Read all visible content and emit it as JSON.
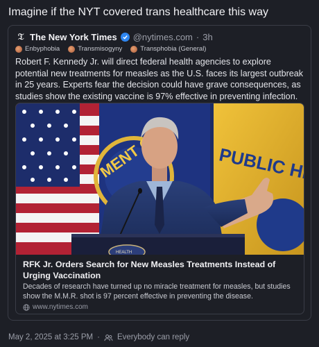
{
  "post": {
    "text": "Imagine if the NYT covered trans healthcare this way",
    "timestamp": "May 2, 2025 at 3:25 PM",
    "separator": "·",
    "reply_setting": "Everybody can reply"
  },
  "quote": {
    "author_name": "The New York Times",
    "handle": "@nytimes.com",
    "separator": "·",
    "age": "3h",
    "labels": [
      "Enbyphobia",
      "Transmisogyny",
      "Transphobia (General)"
    ],
    "text": "Robert F. Kennedy Jr. will direct federal health agencies to explore potential new treatments for measles as the U.S. faces its largest outbreak in 25 years. Experts fear the decision could have grave consequences, as studies show the existing vaccine is 97% effective in preventing infection."
  },
  "embed": {
    "title": "RFK Jr. Orders Search for New Measles Treatments Instead of Urging Vaccination",
    "description": "Decades of research have turned up no miracle treatment for measles, but studies show the M.M.R. shot is 97 percent effective in preventing the disease.",
    "domain": "www.nytimes.com",
    "podium_text": "HEALTH",
    "flag_text": "PUBLIC HE",
    "seal_text": "MENT OF"
  },
  "icons": {
    "logo": "nyt-logo-icon",
    "verified": "verified-badge-icon",
    "globe": "globe-icon",
    "people": "people-icon"
  },
  "colors": {
    "background": "#1d1f26",
    "border": "#3a3d47",
    "muted_text": "#9b9ea8",
    "verified_blue": "#2e86f0"
  }
}
